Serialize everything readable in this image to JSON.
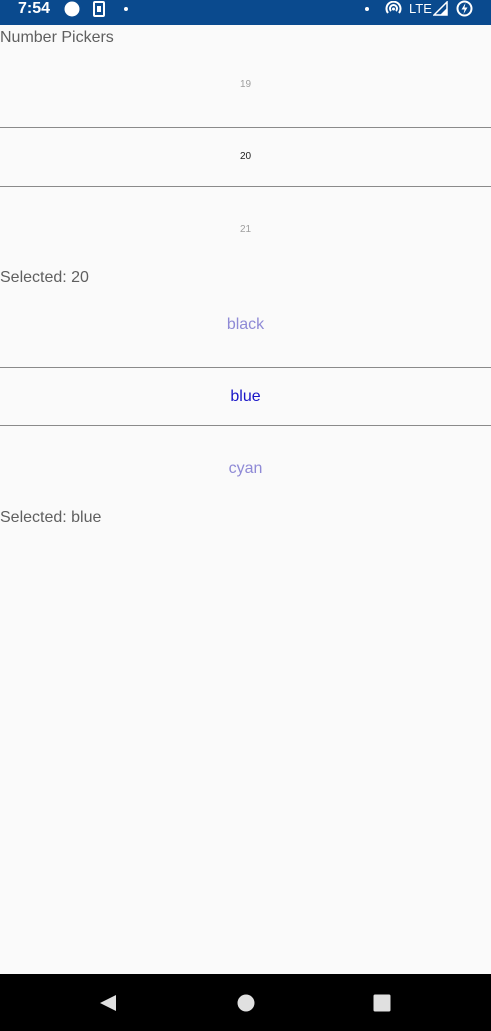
{
  "status_bar": {
    "time": "7:54",
    "network": "LTE",
    "icons": [
      "circle-icon",
      "sim-card-icon",
      "dot-icon",
      "dot-icon",
      "hotspot-icon",
      "signal-icon",
      "battery-charging-icon"
    ]
  },
  "page": {
    "title": "Number Pickers"
  },
  "number_picker": {
    "above": "19",
    "selected": "20",
    "below": "21",
    "selected_label": "Selected: 20"
  },
  "color_picker": {
    "above": "black",
    "selected": "blue",
    "below": "cyan",
    "selected_label": "Selected: blue"
  },
  "nav_bar": {
    "buttons": [
      "back-icon",
      "home-icon",
      "recents-icon"
    ]
  },
  "colors": {
    "status_bar": "#0a4a8e",
    "background": "#fafafa",
    "selected_color_text": "#1a16c8",
    "dim_color_text": "#8f8ad6",
    "divider": "#8a8a8a"
  }
}
